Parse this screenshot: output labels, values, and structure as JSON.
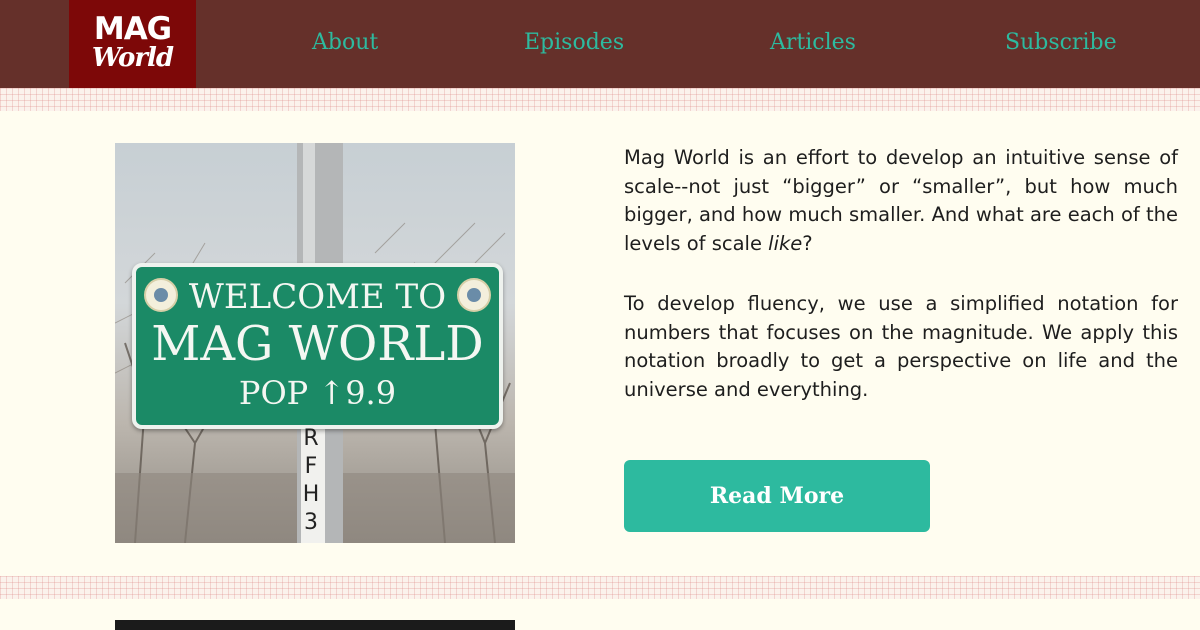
{
  "header": {
    "logo": {
      "line1": "MAG",
      "line2": "World"
    },
    "nav": [
      {
        "label": "About"
      },
      {
        "label": "Episodes"
      },
      {
        "label": "Articles"
      },
      {
        "label": "Subscribe"
      }
    ]
  },
  "hero": {
    "image": {
      "sign_line1": "WELCOME TO",
      "sign_line2": "MAG WORLD",
      "sign_line3": "POP ↑9.9",
      "post_text": "RFH3"
    },
    "paragraphs": [
      {
        "before": "Mag World is an effort to develop an intuitive sense of scale--not just “bigger” or “smaller”, but how much bigger, and how much smaller. And what are each of the levels of scale ",
        "emphasis": "like",
        "after": "?"
      },
      {
        "text": "To develop fluency, we use a simplified notation for numbers that focuses on the magnitude. We apply this notation broadly to get a perspective on life and the universe and everything."
      }
    ],
    "button_label": "Read More"
  },
  "colors": {
    "header_bg": "#65302a",
    "logo_bg": "#7d0808",
    "accent": "#2dba9f",
    "page_bg": "#fffdf0",
    "sign_green": "#1b8a66"
  }
}
